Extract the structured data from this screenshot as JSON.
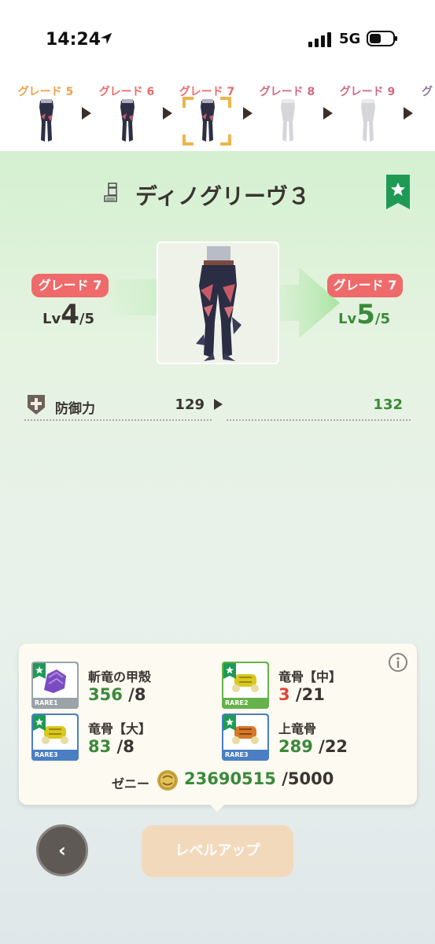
{
  "status_bar": {
    "time": "14:24",
    "network": "5G"
  },
  "grade_strip": [
    {
      "label": "グレード 5",
      "color": "#f0a048",
      "faded": false
    },
    {
      "label": "グレード 6",
      "color": "#ee6a6a",
      "faded": false
    },
    {
      "label": "グレード 7",
      "color": "#ee6a6a",
      "faded": false,
      "selected": true
    },
    {
      "label": "グレード 8",
      "color": "#c2385a",
      "faded": true
    },
    {
      "label": "グレード 9",
      "color": "#c2385a",
      "faded": true
    },
    {
      "label": "グ",
      "color": "#6a4a8a",
      "faded": true
    }
  ],
  "item": {
    "name": "ディノグリーヴ３"
  },
  "upgrade": {
    "left_grade": "グレード 7",
    "left_lv_prefix": "Lv",
    "left_lv": "4",
    "left_lv_max": "/5",
    "right_grade": "グレード 7",
    "right_lv_prefix": "Lv",
    "right_lv": "5",
    "right_lv_max": "/5"
  },
  "stats": {
    "label": "防御力",
    "current": "129",
    "next": "132"
  },
  "materials": [
    {
      "name": "斬竜の甲殻",
      "have": "356",
      "need": " /8",
      "rare": "RARE1",
      "rare_color": "#9aa3a8",
      "ok": true,
      "icon": "purple-shell-icon"
    },
    {
      "name": "竜骨【中】",
      "have": "3",
      "need": " /21",
      "rare": "RARE2",
      "rare_color": "#66b24a",
      "ok": false,
      "icon": "yellow-bone-icon"
    },
    {
      "name": "竜骨【大】",
      "have": "83",
      "need": " /8",
      "rare": "RARE3",
      "rare_color": "#4a7fc4",
      "ok": true,
      "icon": "yellow-bone-icon"
    },
    {
      "name": "上竜骨",
      "have": "289",
      "need": " /22",
      "rare": "RARE3",
      "rare_color": "#4a7fc4",
      "ok": true,
      "icon": "orange-bone-icon"
    }
  ],
  "zeny": {
    "label": "ゼニー",
    "have": "23690515",
    "need": " /5000"
  },
  "buttons": {
    "back": "‹",
    "level_up": "レベルアップ"
  },
  "colors": {
    "ok": "#3a8a3a",
    "ng": "#e0453a",
    "badge": "#ef6a6a",
    "accent_green": "#1f9a55"
  }
}
